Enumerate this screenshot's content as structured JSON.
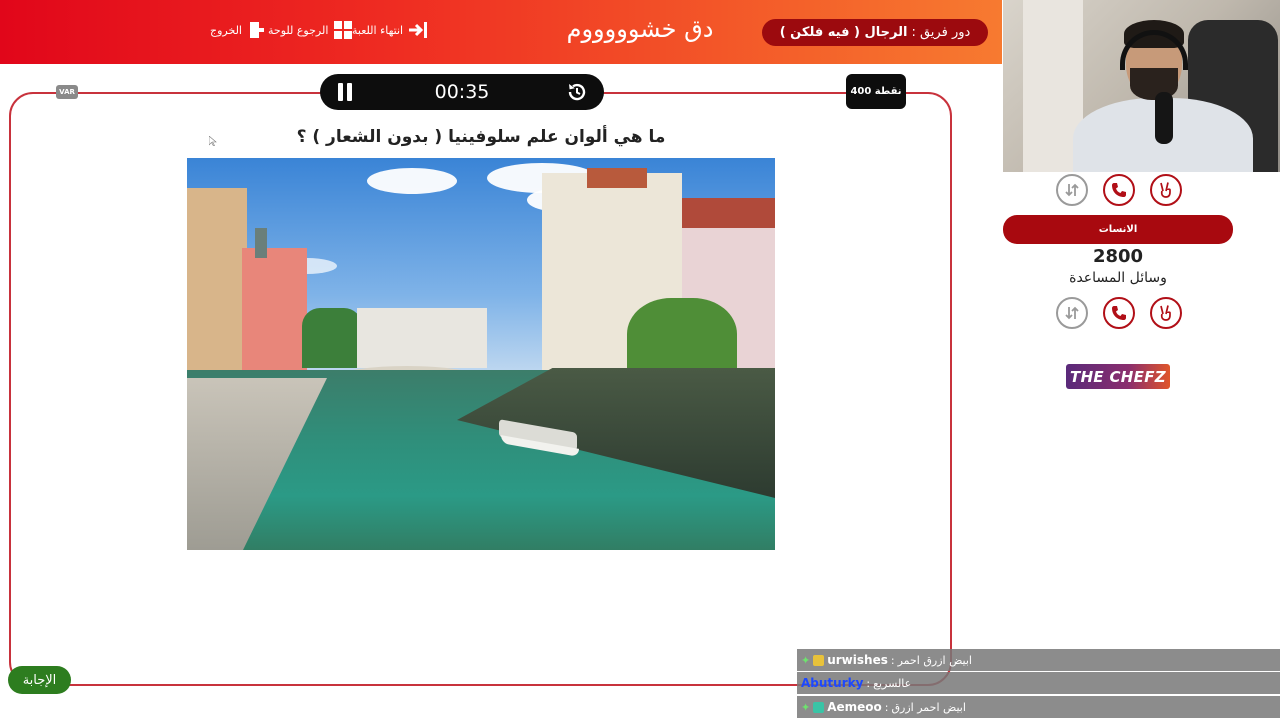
{
  "topbar": {
    "exit_label": "الخروج",
    "board_label": "الرجوع للوحة",
    "end_label": "انتهاء اللعبة",
    "game_title": "دق خشوووووم",
    "turn_prefix": "دور فريق :",
    "turn_team": "الرجال ( فيه فلكن )"
  },
  "game": {
    "var_badge": "VAR",
    "timer": "00:35",
    "points": "400 نقطة",
    "question": "ما هي ألوان علم سلوفينيا ( بدون الشعار ) ؟",
    "answer_label": "الإجابة"
  },
  "side": {
    "team_name": "الانسات",
    "score": "2800",
    "helpers_label": "وسائل المساعدة",
    "sponsor": "THE CHEFZ"
  },
  "chat": [
    {
      "user": "urwishes",
      "message": "ابيض ازرق احمر",
      "badge_color": "#e8c23a"
    },
    {
      "user": "Abuturky",
      "message": "عالسريع",
      "badge_color": "#c43a3a"
    },
    {
      "user": "Aemeoo",
      "message": "ابيض احمر ازرق",
      "badge_color": "#3ac4a6"
    }
  ],
  "colors": {
    "accent_red": "#e1061a",
    "dark_red": "#a8090f",
    "answer_green": "#2d7d1f"
  }
}
